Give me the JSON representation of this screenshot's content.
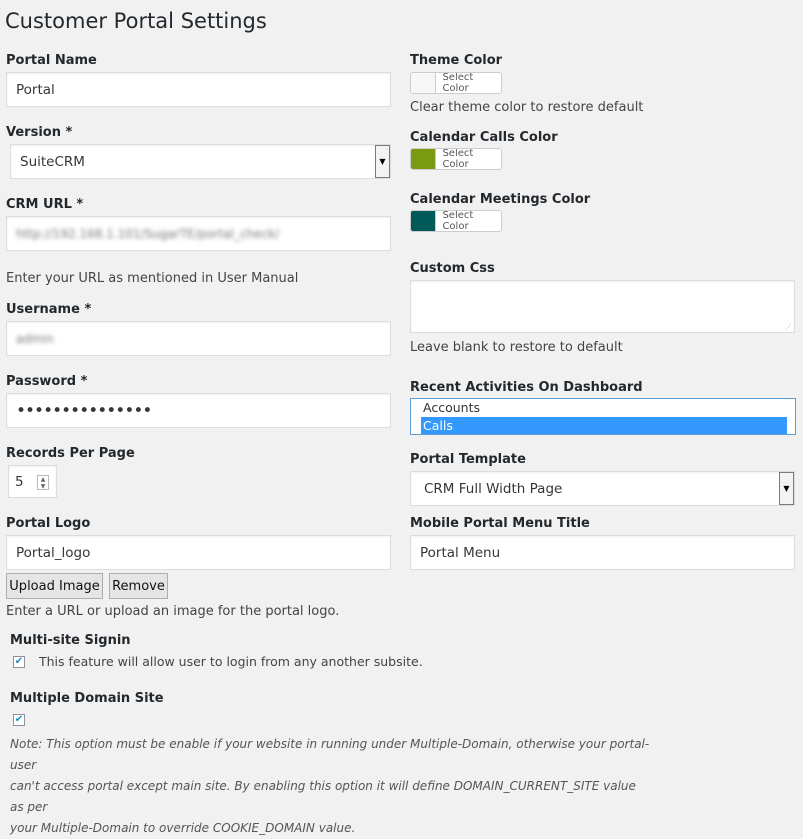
{
  "page_title": "Customer Portal Settings",
  "left": {
    "portal_name": {
      "label": "Portal Name",
      "value": "Portal"
    },
    "version": {
      "label": "Version *",
      "value": "SuiteCRM"
    },
    "crm_url": {
      "label": "CRM URL *",
      "value": "http://192.168.1.101/SugarTE/portal_check/",
      "help": "Enter your URL as mentioned in User Manual"
    },
    "username": {
      "label": "Username *",
      "value": "admin"
    },
    "password": {
      "label": "Password *",
      "value": "•••••••••••••••"
    },
    "records_per_page": {
      "label": "Records Per Page",
      "value": "5"
    },
    "portal_logo": {
      "label": "Portal Logo",
      "value": "Portal_logo",
      "upload_label": "Upload Image",
      "remove_label": "Remove",
      "help": "Enter a URL or upload an image for the portal logo."
    },
    "multi_site": {
      "label": "Multi-site Signin",
      "checked": true,
      "text": "This feature will allow user to login from any another subsite."
    },
    "multiple_domain": {
      "label": "Multiple Domain Site",
      "checked": true,
      "note_lines": [
        "Note: This option must be enable if your website in running under Multiple-Domain, otherwise your portal-user",
        "can't access portal except main site. By enabling this option it will define DOMAIN_CURRENT_SITE value as per",
        "your Multiple-Domain to override COOKIE_DOMAIN value."
      ]
    }
  },
  "right": {
    "theme_color": {
      "label": "Theme Color",
      "button": "Select Color",
      "color": "#f7f7f7",
      "help": "Clear theme color to restore default"
    },
    "calendar_calls_color": {
      "label": "Calendar Calls Color",
      "button": "Select Color",
      "color": "#7a9a12"
    },
    "calendar_meetings_color": {
      "label": "Calendar Meetings Color",
      "button": "Select Color",
      "color": "#005a5a"
    },
    "custom_css": {
      "label": "Custom Css",
      "value": "",
      "help": "Leave blank to restore to default"
    },
    "recent_activities": {
      "label": "Recent Activities On Dashboard",
      "options": [
        "Accounts",
        "Calls"
      ],
      "selected": "Calls"
    },
    "portal_template": {
      "label": "Portal Template",
      "value": "CRM Full Width Page"
    },
    "mobile_menu_title": {
      "label": "Mobile Portal Menu Title",
      "value": "Portal Menu"
    }
  },
  "icons": {
    "dropdown": "chevron-down-icon",
    "check": "check-icon",
    "resize": "resize-grip-icon"
  },
  "colors": {
    "selection": "#3399ff",
    "focus_border": "#5b9dd9"
  }
}
